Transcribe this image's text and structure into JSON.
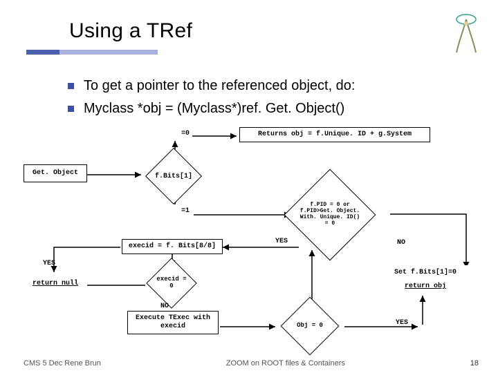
{
  "title": "Using a TRef",
  "bullets": [
    "To get a pointer to the referenced object, do:",
    "Myclass *obj = (Myclass*)ref. Get. Object()"
  ],
  "diagram": {
    "getobject": "Get. Object",
    "fbits": "f.Bits[1]",
    "eq0": "=0",
    "eq1": "=1",
    "ret0": "Returns obj = f.Unique. ID + g.System",
    "fpid": "f.PID = 0  or\nf.PID>Get. Object. With. Unique. ID() = 0",
    "execid_box": "execid = f. Bits[8/8]",
    "yes1": "YES",
    "no1": "NO",
    "yes_left": "YES",
    "return_null": "return null",
    "execid0": "execid = 0",
    "no2": "NO",
    "exec_texec": "Execute TExec\nwith execid",
    "obj0": "Obj = 0",
    "setfbits": "Set f.Bits[1]=0",
    "return_obj": "return obj",
    "yes2": "YES"
  },
  "footer": {
    "left": "CMS 5 Dec  Rene Brun",
    "center": "ZOOM on ROOT files & Containers",
    "page": "18"
  }
}
